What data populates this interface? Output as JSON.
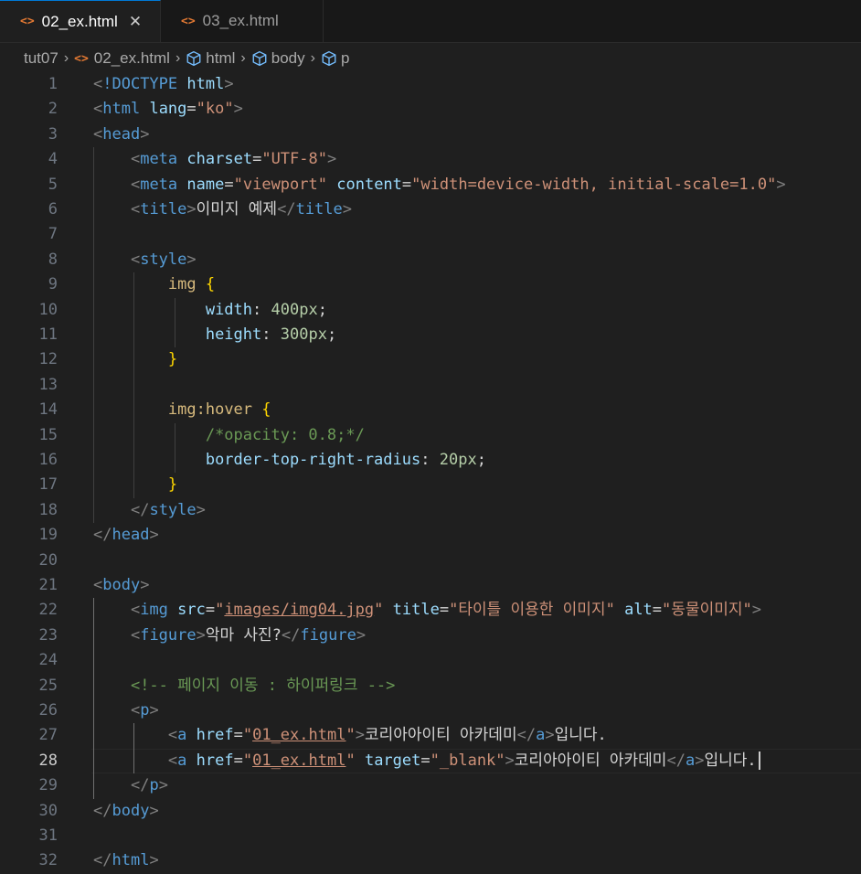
{
  "tabs": [
    {
      "label": "02_ex.html",
      "icon": "html-file-icon",
      "active": true,
      "close": "✕"
    },
    {
      "label": "03_ex.html",
      "icon": "html-file-icon",
      "active": false
    }
  ],
  "breadcrumb": {
    "folder": "tut07",
    "file": "02_ex.html",
    "symbols": [
      "html",
      "body",
      "p"
    ]
  },
  "editor": {
    "current_line": 28,
    "line_numbers": [
      "1",
      "2",
      "3",
      "4",
      "5",
      "6",
      "7",
      "8",
      "9",
      "10",
      "11",
      "12",
      "13",
      "14",
      "15",
      "16",
      "17",
      "18",
      "19",
      "20",
      "21",
      "22",
      "23",
      "24",
      "25",
      "26",
      "27",
      "28",
      "29",
      "30",
      "31",
      "32"
    ],
    "lines": [
      "<!DOCTYPE html>",
      "<html lang=\"ko\">",
      "<head>",
      "    <meta charset=\"UTF-8\">",
      "    <meta name=\"viewport\" content=\"width=device-width, initial-scale=1.0\">",
      "    <title>이미지 예제</title>",
      "",
      "    <style>",
      "        img {",
      "            width: 400px;",
      "            height: 300px;",
      "        }",
      "",
      "        img:hover {",
      "            /*opacity: 0.8;*/",
      "            border-top-right-radius: 20px;",
      "        }",
      "    </style>",
      "</head>",
      "",
      "<body>",
      "    <img src=\"images/img04.jpg\" title=\"타이틀 이용한 이미지\" alt=\"동물이미지\">",
      "    <figure>악마 사진?</figure>",
      "",
      "    <!-- 페이지 이동 : 하이퍼링크 -->",
      "    <p>",
      "        <a href=\"01_ex.html\">코리아아이티 아카데미</a>입니다.",
      "        <a href=\"01_ex.html\" target=\"_blank\">코리아아이티 아카데미</a>입니다.",
      "    </p>",
      "</body>",
      "",
      "</html>"
    ]
  },
  "colors": {
    "background": "#1f1f1f",
    "tag": "#569cd6",
    "attribute": "#9cdcfe",
    "string": "#ce9178",
    "comment": "#6a9955",
    "number": "#b5cea8",
    "selector": "#d7ba7d",
    "brace": "#ffd700",
    "file_icon": "#e37933"
  }
}
